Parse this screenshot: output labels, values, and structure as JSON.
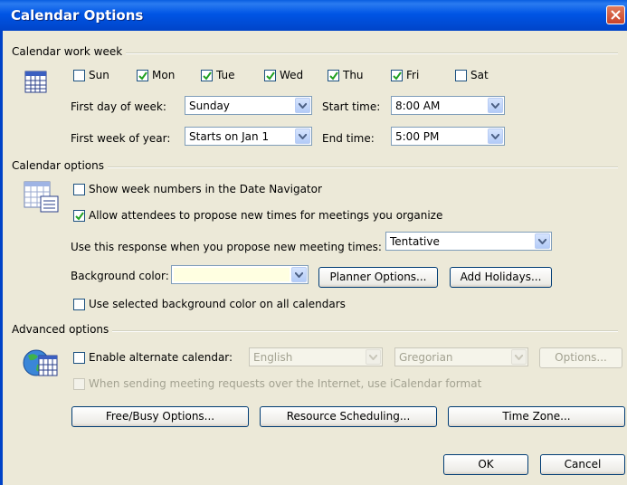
{
  "window": {
    "title": "Calendar Options"
  },
  "work_week": {
    "heading": "Calendar work week",
    "days": [
      {
        "label": "Sun",
        "checked": false
      },
      {
        "label": "Mon",
        "checked": true
      },
      {
        "label": "Tue",
        "checked": true
      },
      {
        "label": "Wed",
        "checked": true
      },
      {
        "label": "Thu",
        "checked": true
      },
      {
        "label": "Fri",
        "checked": true
      },
      {
        "label": "Sat",
        "checked": false
      }
    ],
    "first_day_label": "First day of week:",
    "first_day_value": "Sunday",
    "first_week_label": "First week of year:",
    "first_week_value": "Starts on Jan 1",
    "start_time_label": "Start time:",
    "start_time_value": "8:00 AM",
    "end_time_label": "End time:",
    "end_time_value": "5:00 PM"
  },
  "calendar_options": {
    "heading": "Calendar options",
    "show_week_numbers": {
      "label": "Show week numbers in the Date Navigator",
      "checked": false
    },
    "allow_propose": {
      "label": "Allow attendees to propose new times for meetings you organize",
      "checked": true
    },
    "response_label": "Use this response when you propose new meeting times:",
    "response_value": "Tentative",
    "bg_color_label": "Background color:",
    "bg_color_value": "#ffffe1",
    "planner_button": "Planner Options...",
    "holidays_button": "Add Holidays...",
    "use_bg_all": {
      "label": "Use selected background color on all calendars",
      "checked": false
    }
  },
  "advanced": {
    "heading": "Advanced options",
    "alt_calendar": {
      "label": "Enable alternate calendar:",
      "checked": false
    },
    "language_value": "English",
    "calendar_type_value": "Gregorian",
    "options_button": "Options...",
    "icalendar": {
      "label": "When sending meeting requests over the Internet, use iCalendar format",
      "checked": false
    },
    "freebusy_button": "Free/Busy Options...",
    "resource_button": "Resource Scheduling...",
    "timezone_button": "Time Zone..."
  },
  "footer": {
    "ok": "OK",
    "cancel": "Cancel"
  },
  "colors": {
    "title_bar": "#0055e5",
    "dialog_bg": "#ece9d8",
    "checkbox_check": "#21a121",
    "close_button": "#c8422a"
  }
}
